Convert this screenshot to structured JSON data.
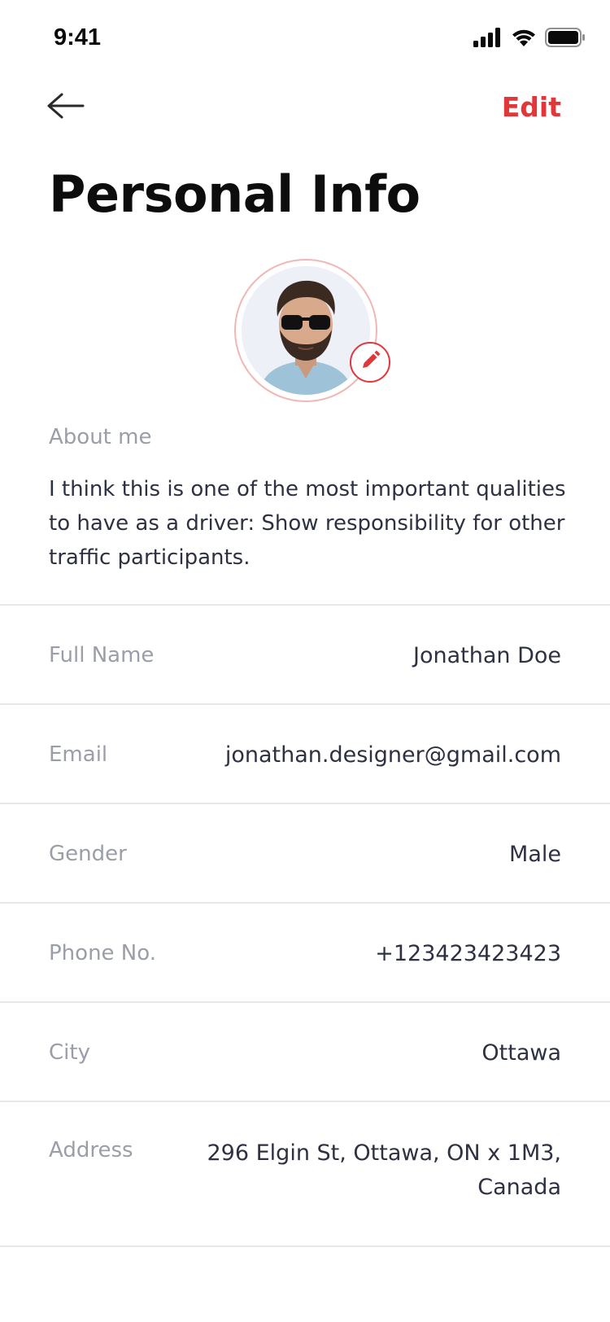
{
  "status_bar": {
    "time": "9:41",
    "icons": [
      "signal-icon",
      "wifi-icon",
      "battery-icon"
    ]
  },
  "nav": {
    "back_icon": "arrow-left-icon",
    "edit_label": "Edit"
  },
  "page": {
    "title": "Personal Info"
  },
  "avatar": {
    "edit_icon": "pencil-icon"
  },
  "about": {
    "label": "About me",
    "text": "I think this is one of the most important qualities to have as a driver: Show responsibility for other traffic participants."
  },
  "fields": [
    {
      "label": "Full Name",
      "value": "Jonathan Doe"
    },
    {
      "label": "Email",
      "value": "jonathan.designer@gmail.com"
    },
    {
      "label": "Gender",
      "value": "Male"
    },
    {
      "label": "Phone No.",
      "value": "+123423423423"
    },
    {
      "label": "City",
      "value": "Ottawa"
    },
    {
      "label": "Address",
      "value": "296 Elgin St, Ottawa, ON x 1M3, Canada"
    }
  ],
  "colors": {
    "accent": "#e1373b",
    "label": "#9a9ea8",
    "value": "#2d3142",
    "divider": "#e6e7eb"
  }
}
